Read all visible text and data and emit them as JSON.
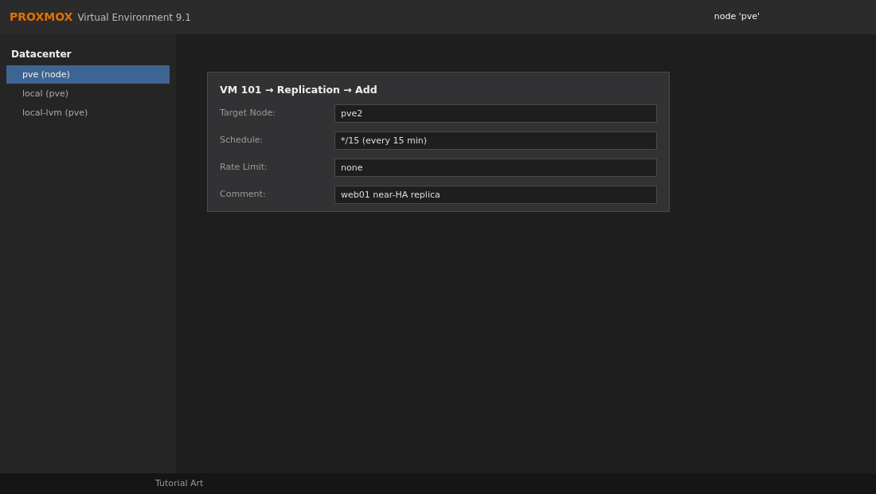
{
  "header": {
    "logo": "PROXMOX",
    "product": "Virtual Environment 9.1",
    "context": "node 'pve'"
  },
  "sidebar": {
    "title": "Datacenter",
    "items": [
      {
        "label": "pve (node)",
        "selected": true
      },
      {
        "label": "local (pve)",
        "selected": false
      },
      {
        "label": "local-lvm (pve)",
        "selected": false
      }
    ]
  },
  "panel": {
    "title": "VM 101 → Replication → Add",
    "fields": [
      {
        "label": "Target Node:",
        "value": "pve2"
      },
      {
        "label": "Schedule:",
        "value": "*/15 (every 15 min)"
      },
      {
        "label": "Rate Limit:",
        "value": "none"
      },
      {
        "label": "Comment:",
        "value": "web01 near-HA replica"
      }
    ]
  },
  "footer": {
    "text": "Tutorial Art"
  }
}
